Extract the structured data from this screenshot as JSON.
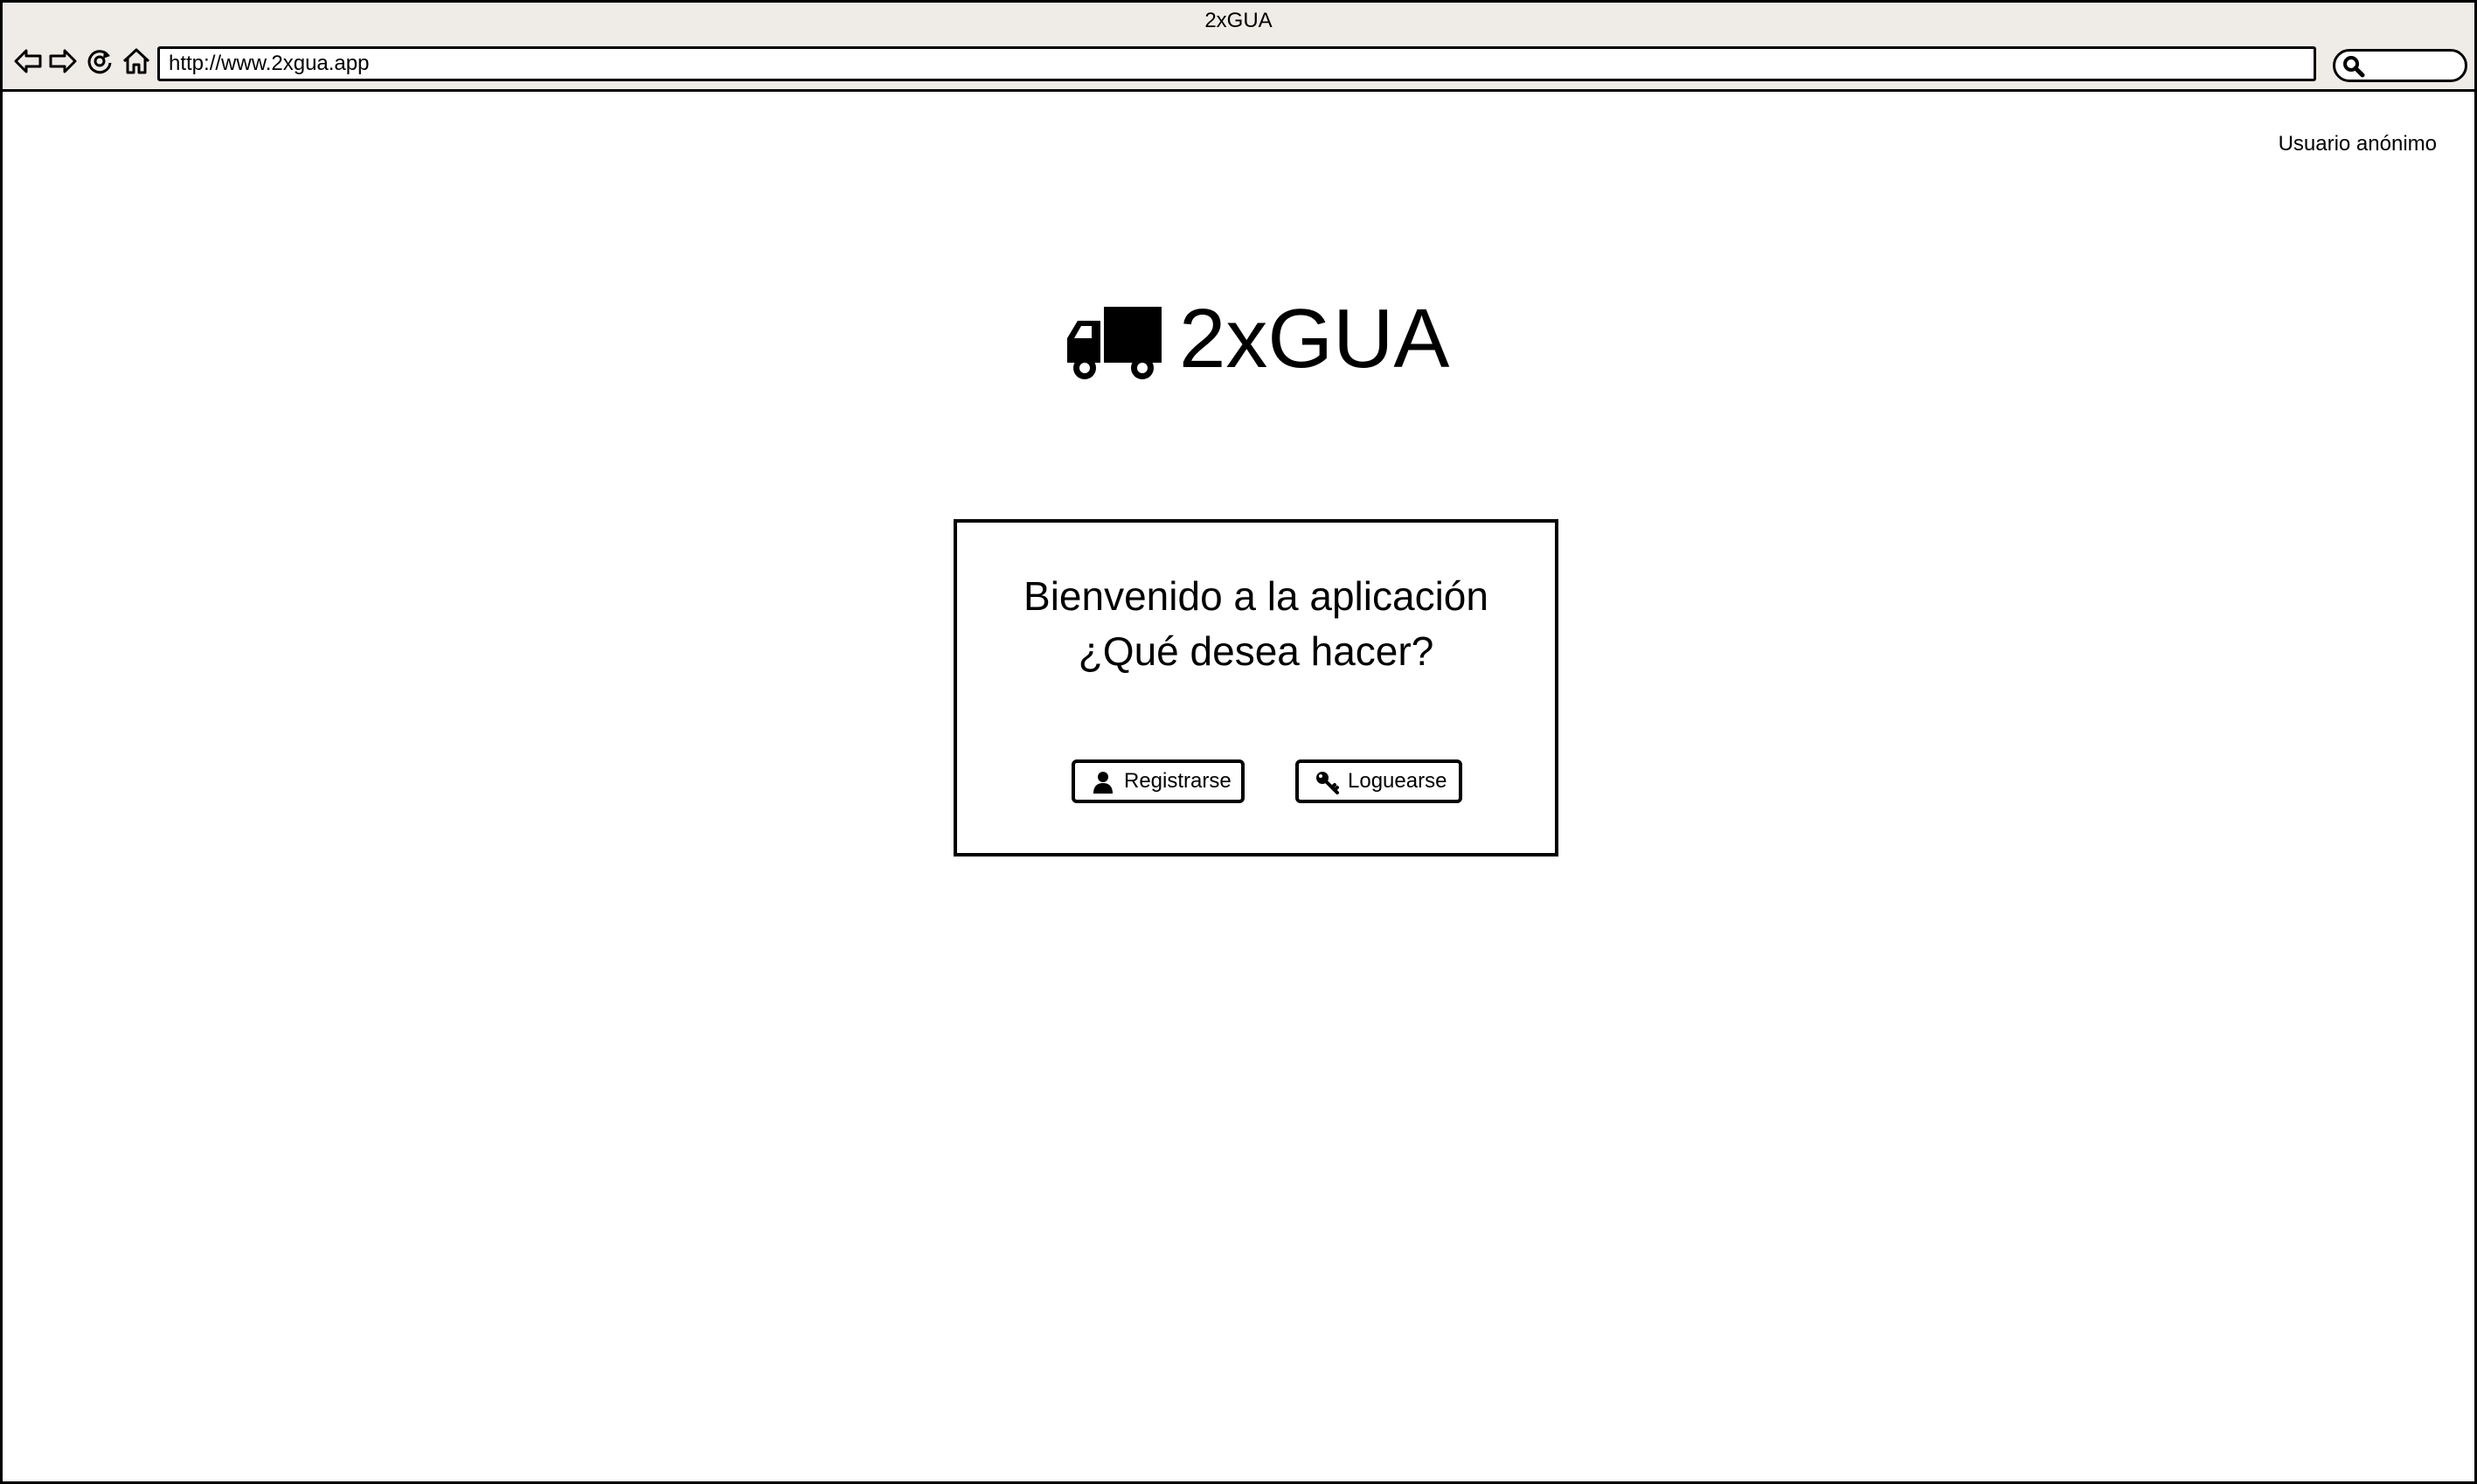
{
  "browser": {
    "window_title": "2xGUA",
    "url": "http://www.2xgua.app",
    "icons": [
      "back-arrow-icon",
      "forward-arrow-icon",
      "reload-icon",
      "home-icon",
      "search-icon"
    ]
  },
  "header": {
    "user_label": "Usuario anónimo"
  },
  "logo": {
    "icon": "truck-icon",
    "text": "2xGUA"
  },
  "welcome": {
    "line1": "Bienvenido a la aplicación",
    "line2": "¿Qué desea hacer?",
    "register_label": "Registrarse",
    "register_icon": "user-icon",
    "login_label": "Loguearse",
    "login_icon": "key-icon"
  }
}
